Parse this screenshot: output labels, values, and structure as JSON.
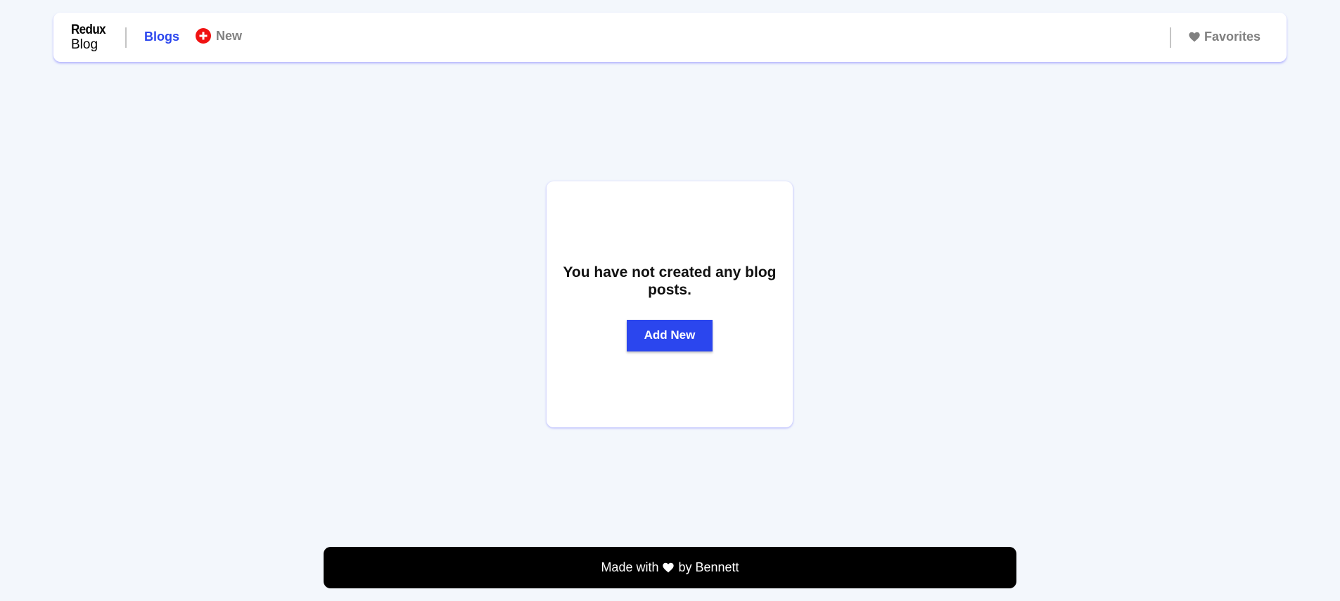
{
  "navbar": {
    "brand_top": "Redux",
    "brand_bottom": "Blog",
    "blogs_label": "Blogs",
    "new_label": "New",
    "favorites_label": "Favorites",
    "icons": {
      "new": "plus-circle-icon",
      "favorites": "heart-icon"
    },
    "colors": {
      "active_link": "#2b46ee",
      "inactive_link": "#808080",
      "plus_icon": "#f01212"
    }
  },
  "main": {
    "empty_message": "You have not created any blog posts.",
    "add_new_label": "Add New",
    "colors": {
      "button": "#2b46ee"
    }
  },
  "footer": {
    "prefix": "Made with",
    "suffix": "by Bennett",
    "icon": "heart-icon",
    "colors": {
      "background": "#000000",
      "text": "#ffffff"
    }
  }
}
